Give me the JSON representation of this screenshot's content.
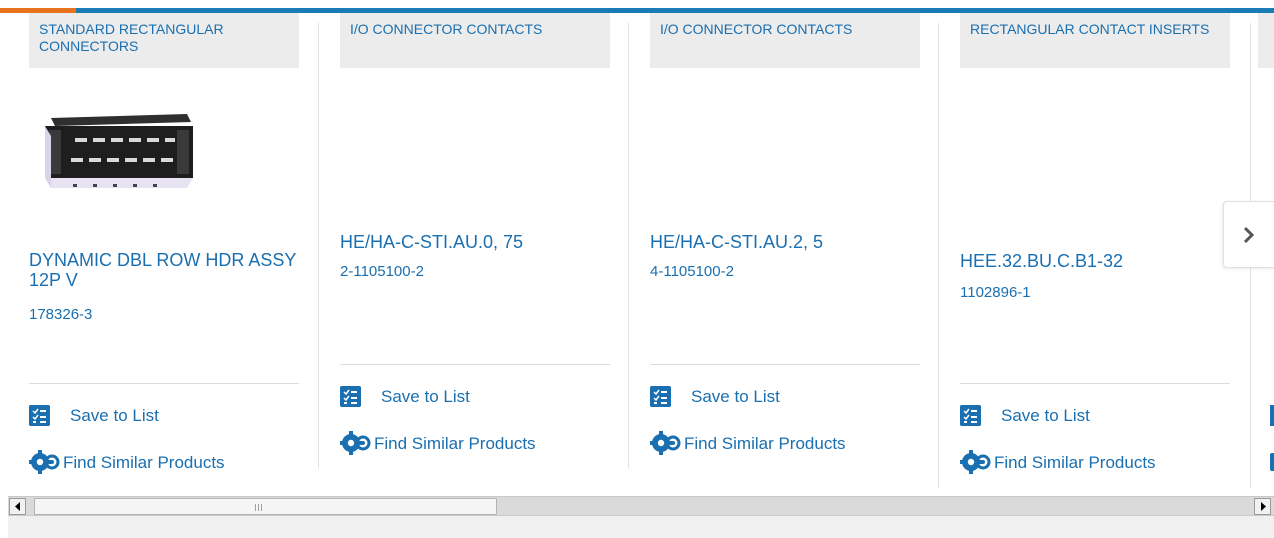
{
  "colors": {
    "link": "#1a6fb0",
    "accent_bar": "#1a7bb5",
    "accent_orange": "#e8731f"
  },
  "cards": [
    {
      "category": "STANDARD RECTANGULAR CONNECTORS",
      "title": "DYNAMIC DBL ROW HDR ASSY 12P V",
      "part_number": "178326-3",
      "save_label": "Save to List",
      "similar_label": "Find Similar Products",
      "image": "connector-photo"
    },
    {
      "category": "I/O CONNECTOR CONTACTS",
      "title": "HE/HA-C-STI.AU.0, 75",
      "part_number": "2-1105100-2",
      "save_label": "Save to List",
      "similar_label": "Find Similar Products"
    },
    {
      "category": "I/O CONNECTOR CONTACTS",
      "title": "HE/HA-C-STI.AU.2, 5",
      "part_number": "4-1105100-2",
      "save_label": "Save to List",
      "similar_label": "Find Similar Products"
    },
    {
      "category": "RECTANGULAR CONTACT INSERTS",
      "title": "HEE.32.BU.C.B1-32",
      "part_number": "1102896-1",
      "save_label": "Save to List",
      "similar_label": "Find Similar Products"
    }
  ],
  "carousel": {
    "next_icon": "chevron-right-icon"
  },
  "scrollbar": {
    "left_icon": "arrow-left-icon",
    "right_icon": "arrow-right-icon"
  }
}
